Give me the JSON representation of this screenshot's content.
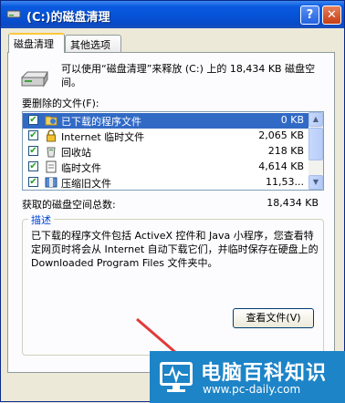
{
  "window": {
    "title": "(C:)的磁盘清理",
    "help_glyph": "?",
    "close_glyph": "✕"
  },
  "tabs": [
    {
      "label": "磁盘清理",
      "active": true
    },
    {
      "label": "其他选项",
      "active": false
    }
  ],
  "intro_text": "可以使用“磁盘清理”来释放 (C:) 上的 18,434 KB 磁盘空间。",
  "list_label": "要删除的文件(F):",
  "files": [
    {
      "name": "已下载的程序文件",
      "size": "0 KB",
      "checked": true,
      "selected": true,
      "icon": "folder-icon"
    },
    {
      "name": "Internet 临时文件",
      "size": "2,065 KB",
      "checked": true,
      "selected": false,
      "icon": "lock-icon"
    },
    {
      "name": "回收站",
      "size": "218 KB",
      "checked": true,
      "selected": false,
      "icon": "recycle-bin-icon"
    },
    {
      "name": "临时文件",
      "size": "4,614 KB",
      "checked": true,
      "selected": false,
      "icon": "document-icon"
    },
    {
      "name": "压缩旧文件",
      "size": "11,53...",
      "checked": true,
      "selected": false,
      "icon": "compress-icon"
    }
  ],
  "total_label": "获取的磁盘空间总数:",
  "total_value": "18,434 KB",
  "description": {
    "title": "描述",
    "text": "已下载的程序文件包括 ActiveX 控件和 Java 小程序，您查看特定网页时将会从 Internet 自动下载它们，并临时保存在硬盘上的 Downloaded Program Files 文件夹中。"
  },
  "view_files_button": "查看文件(V)",
  "watermark": {
    "title": "电脑百科知识",
    "url": "www.pc-daily.com"
  },
  "colors": {
    "titlebar": "#0553d6",
    "selection": "#316ac5",
    "group_title": "#0046d5",
    "watermark_bg": "#1d84c7",
    "arrow": "#e23a3a"
  }
}
